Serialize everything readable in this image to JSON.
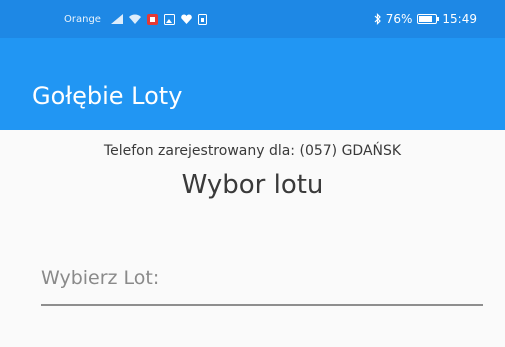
{
  "status_bar": {
    "carrier": "Orange",
    "battery_text": "76%",
    "battery_level": 0.76,
    "time": "15:49",
    "icons": [
      "signal-icon",
      "wifi-icon",
      "notification-icon",
      "gallery-icon",
      "heart-icon",
      "sim-icon",
      "bluetooth-icon",
      "battery-icon"
    ]
  },
  "app_bar": {
    "title": "Gołębie Loty"
  },
  "content": {
    "subtitle": "Telefon zarejestrowany dla: (057) GDAŃSK",
    "heading": "Wybor lotu",
    "flight_field": {
      "placeholder": "Wybierz Lot:",
      "value": ""
    }
  },
  "colors": {
    "status_bar": "#1e88e5",
    "app_bar": "#2196f3",
    "background": "#fafafa"
  }
}
